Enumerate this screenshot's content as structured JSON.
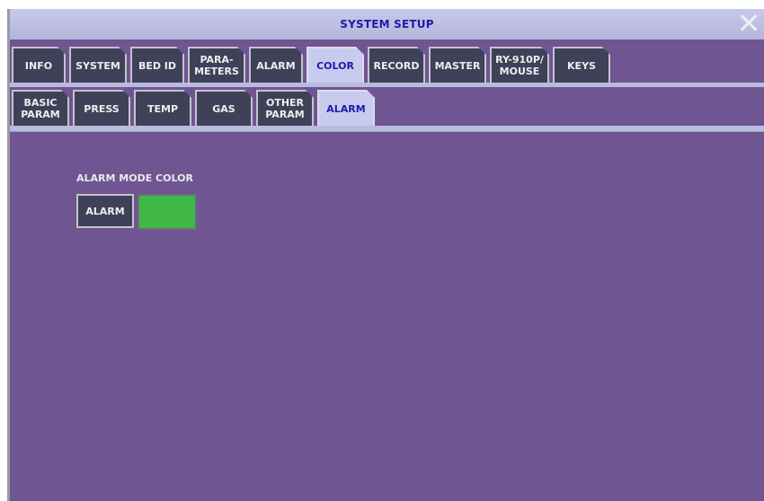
{
  "window": {
    "title": "SYSTEM SETUP",
    "close_glyph": "✕"
  },
  "tabs_row1": [
    {
      "label": "INFO",
      "active": false
    },
    {
      "label": "SYSTEM",
      "active": false
    },
    {
      "label": "BED ID",
      "active": false
    },
    {
      "label": "PARA-\nMETERS",
      "active": false
    },
    {
      "label": "ALARM",
      "active": false
    },
    {
      "label": "COLOR",
      "active": true
    },
    {
      "label": "RECORD",
      "active": false
    },
    {
      "label": "MASTER",
      "active": false
    },
    {
      "label": "RY-910P/\nMOUSE",
      "active": false
    },
    {
      "label": "KEYS",
      "active": false
    }
  ],
  "tabs_row2": [
    {
      "label": "BASIC\nPARAM",
      "active": false
    },
    {
      "label": "PRESS",
      "active": false
    },
    {
      "label": "TEMP",
      "active": false
    },
    {
      "label": "GAS",
      "active": false
    },
    {
      "label": "OTHER\nPARAM",
      "active": false
    },
    {
      "label": "ALARM",
      "active": true
    }
  ],
  "alarm_mode": {
    "section_label": "ALARM MODE COLOR",
    "button_label": "ALARM",
    "color": "#40b848"
  },
  "colors": {
    "background": "#6f5591",
    "tab_inactive": "#3f4158",
    "tab_active": "#c9cbee",
    "title_text": "#1c1ca8"
  }
}
